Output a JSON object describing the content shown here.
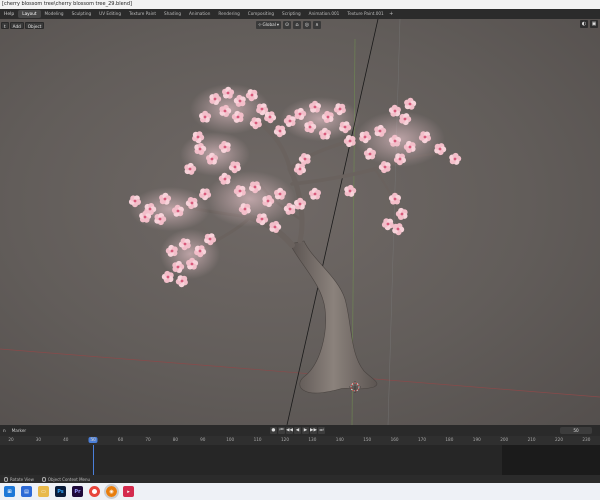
{
  "window": {
    "title": "[cherry blossom tree\\cherry blossom tree_29.blend]"
  },
  "menubar": {
    "help_label": "Help",
    "tabs": [
      "Layout",
      "Modeling",
      "Sculpting",
      "UV Editing",
      "Texture Paint",
      "Shading",
      "Animation",
      "Rendering",
      "Compositing",
      "Scripting",
      "Animation.001",
      "Texture Paint.001"
    ],
    "active_tab": "Layout",
    "add_tab_label": "+"
  },
  "viewport_header": {
    "left_buttons": [
      "t",
      "Add",
      "Object"
    ],
    "orientation": "Global",
    "right_icon": "viewport-shading-icon"
  },
  "timeline": {
    "menu": [
      "n",
      "Marker"
    ],
    "playback_icons": [
      "record-icon",
      "jump-start-icon",
      "step-back-icon",
      "play-reverse-icon",
      "play-icon",
      "step-forward-icon",
      "jump-end-icon"
    ],
    "current_frame": "50",
    "frame_box": "50",
    "ruler_ticks": [
      "20",
      "30",
      "40",
      "50",
      "60",
      "70",
      "80",
      "90",
      "100",
      "110",
      "120",
      "130",
      "140",
      "150",
      "160",
      "170",
      "180",
      "190",
      "200",
      "210",
      "220",
      "230"
    ]
  },
  "statusbar": {
    "items": [
      {
        "icon": "mouse-middle-icon",
        "label": "Rotate View"
      },
      {
        "icon": "mouse-right-icon",
        "label": "Object Context Menu"
      }
    ]
  },
  "taskbar": {
    "icons": [
      "windows-start-icon",
      "store-icon",
      "file-explorer-icon",
      "photoshop-icon",
      "premiere-icon",
      "chrome-icon",
      "blender-icon",
      "extra-app-icon"
    ],
    "icon_labels": {
      "photoshop": "Ps",
      "premiere": "Pr"
    }
  },
  "colors": {
    "viewport_bg": "#625d5a",
    "blossom": "#f4c6d0",
    "bark": "#6e6560",
    "accent_blue": "#4b7fd9"
  }
}
